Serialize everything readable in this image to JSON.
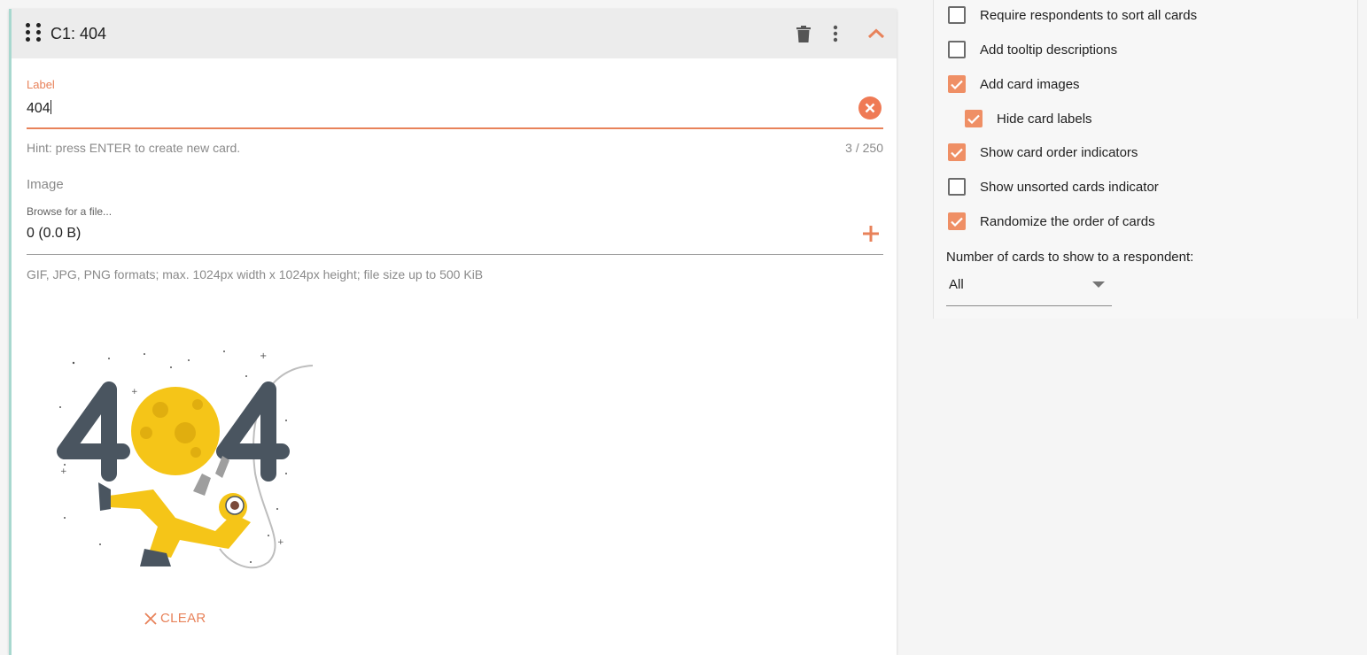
{
  "card": {
    "title": "C1: 404",
    "label_field": {
      "label": "Label",
      "value": "404",
      "hint": "Hint: press ENTER to create new card.",
      "counter": "3 / 250"
    },
    "image_field": {
      "section_label": "Image",
      "browse_label": "Browse for a file...",
      "value": "0 (0.0 B)",
      "hint": "GIF, JPG, PNG formats; max. 1024px width x 1024px height; file size up to 500 KiB"
    },
    "clear_label": "CLEAR"
  },
  "options": [
    {
      "label": "Require respondents to sort all cards",
      "checked": false
    },
    {
      "label": "Add tooltip descriptions",
      "checked": false
    },
    {
      "label": "Add card images",
      "checked": true
    },
    {
      "label": "Hide card labels",
      "checked": true
    },
    {
      "label": "Show card order indicators",
      "checked": true
    },
    {
      "label": "Show unsorted cards indicator",
      "checked": false
    },
    {
      "label": "Randomize the order of cards",
      "checked": true
    }
  ],
  "cards_to_show": {
    "label": "Number of cards to show to a respondent:",
    "selected": "All"
  },
  "colors": {
    "accent": "#ef8f65",
    "header_bg": "#ececec",
    "card_border": "#a8d8cf"
  }
}
